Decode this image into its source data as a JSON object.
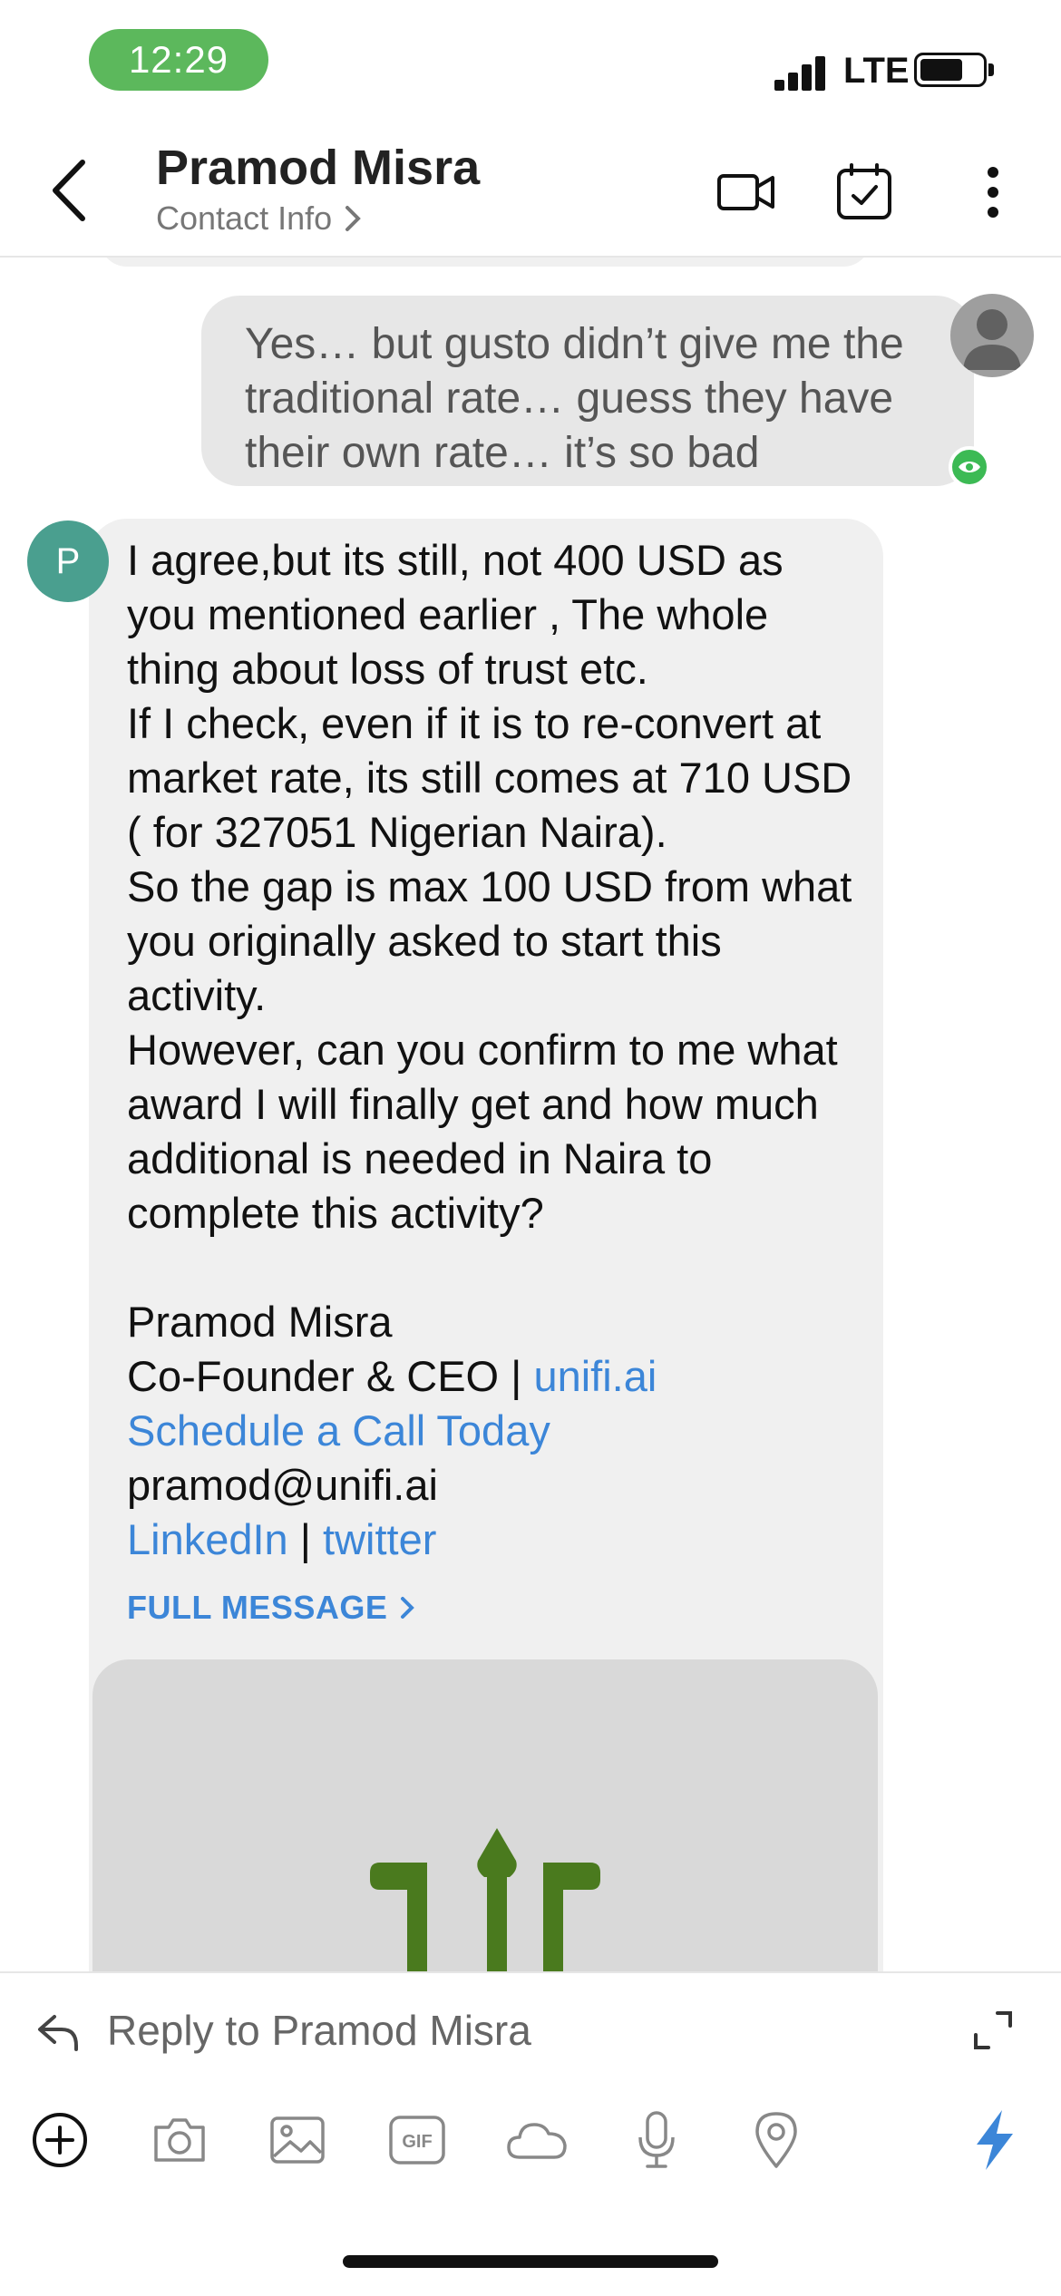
{
  "status_bar": {
    "time": "12:29",
    "network": "LTE",
    "signal_level": 4,
    "battery_percent": 70
  },
  "header": {
    "contact_name": "Pramod Misra",
    "contact_info_label": "Contact Info"
  },
  "messages": {
    "outgoing": {
      "text": "Yes… but gusto didn’t give me the traditional rate… guess they have their own rate… it’s so bad"
    },
    "incoming": {
      "avatar_initial": "P",
      "body": "I agree,but its still, not 400 USD as you mentioned earlier , The whole thing about loss of trust etc.\nIf I check, even if it is to re-convert at market rate, its still comes at 710 USD ( for 327051 Nigerian Naira).\nSo the gap is max 100 USD from what you originally asked to start this activity.\nHowever, can you confirm to me what award I will finally get and how much additional is needed in Naira to complete this activity?",
      "signature": {
        "name": "Pramod Misra",
        "title": "Co-Founder & CEO |",
        "company_link": "unifi.ai",
        "schedule_link": "Schedule a Call Today",
        "email": "pramod@unifi.ai",
        "linkedin_link": "LinkedIn",
        "separator": "|",
        "twitter_link": "twitter"
      },
      "full_message_label": "FULL MESSAGE"
    }
  },
  "reply": {
    "placeholder": "Reply to Pramod Misra"
  },
  "toolbar": {
    "icons": [
      "add-icon",
      "camera-icon",
      "image-icon",
      "gif-icon",
      "cloud-icon",
      "microphone-icon",
      "location-icon",
      "lightning-icon"
    ],
    "gif_label": "GIF"
  },
  "colors": {
    "accent": "#3c86d8",
    "status_green": "#5cb85c",
    "avatar_teal": "#4a9f8f",
    "logo_green": "#4a7a1e"
  }
}
